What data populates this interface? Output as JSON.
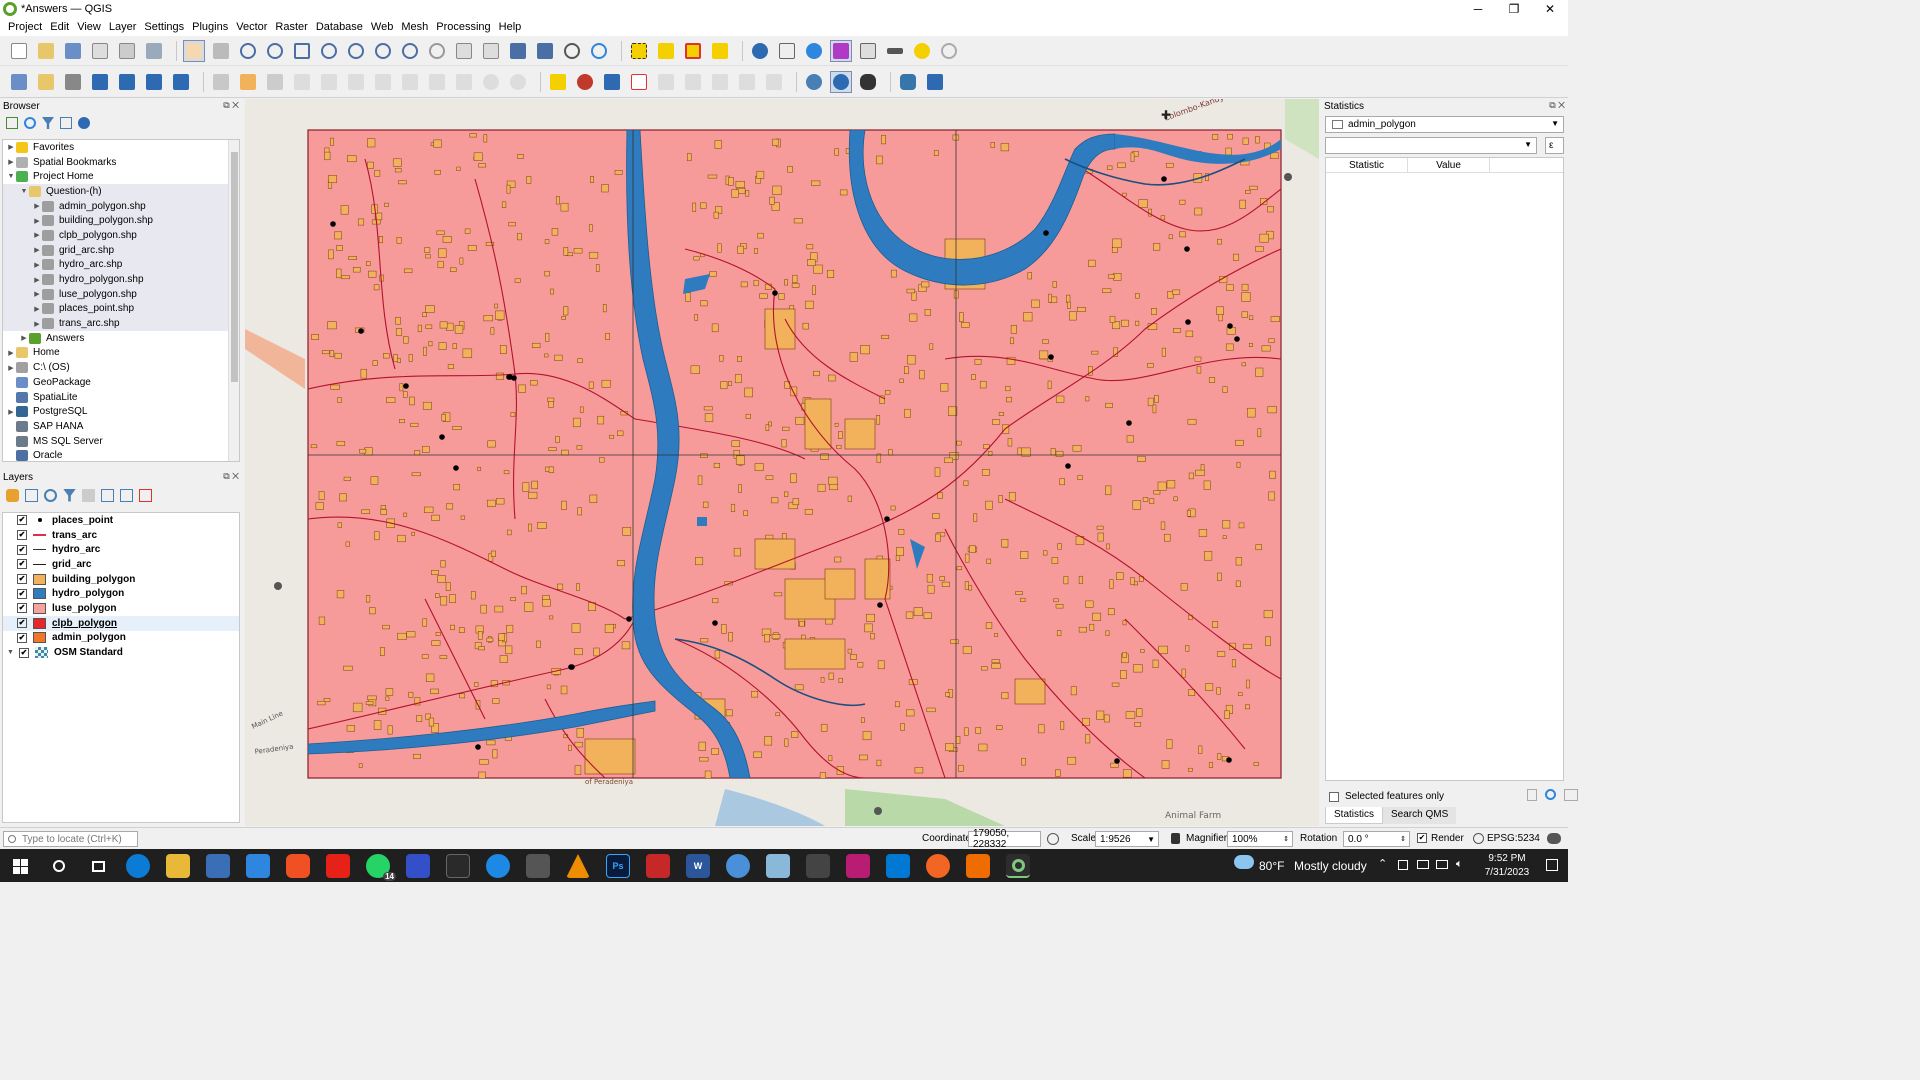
{
  "window": {
    "title": "*Answers — QGIS",
    "minimize": "─",
    "maximize": "❐",
    "close": "✕"
  },
  "menu": [
    "Project",
    "Edit",
    "View",
    "Layer",
    "Settings",
    "Plugins",
    "Vector",
    "Raster",
    "Database",
    "Web",
    "Mesh",
    "Processing",
    "Help"
  ],
  "browser": {
    "title": "Browser",
    "items": [
      {
        "label": "Favorites",
        "icon": "star-icon",
        "color": "#f5c518",
        "level": 0,
        "arrow": "▶"
      },
      {
        "label": "Spatial Bookmarks",
        "icon": "bookmark-icon",
        "color": "#b0b0b0",
        "level": 0,
        "arrow": "▶"
      },
      {
        "label": "Project Home",
        "icon": "project-home-icon",
        "color": "#4caf50",
        "level": 0,
        "arrow": "▼"
      },
      {
        "label": "Question-(h)",
        "icon": "folder-icon",
        "color": "#e8c66a",
        "level": 1,
        "arrow": "▼"
      },
      {
        "label": "admin_polygon.shp",
        "icon": "shapefile-icon",
        "color": "#9e9e9e",
        "level": 2,
        "arrow": "▶"
      },
      {
        "label": "building_polygon.shp",
        "icon": "shapefile-icon",
        "color": "#9e9e9e",
        "level": 2,
        "arrow": "▶"
      },
      {
        "label": "clpb_polygon.shp",
        "icon": "shapefile-icon",
        "color": "#9e9e9e",
        "level": 2,
        "arrow": "▶"
      },
      {
        "label": "grid_arc.shp",
        "icon": "shapefile-icon",
        "color": "#9e9e9e",
        "level": 2,
        "arrow": "▶"
      },
      {
        "label": "hydro_arc.shp",
        "icon": "shapefile-icon",
        "color": "#9e9e9e",
        "level": 2,
        "arrow": "▶"
      },
      {
        "label": "hydro_polygon.shp",
        "icon": "shapefile-icon",
        "color": "#9e9e9e",
        "level": 2,
        "arrow": "▶"
      },
      {
        "label": "luse_polygon.shp",
        "icon": "shapefile-icon",
        "color": "#9e9e9e",
        "level": 2,
        "arrow": "▶"
      },
      {
        "label": "places_point.shp",
        "icon": "shapefile-icon",
        "color": "#9e9e9e",
        "level": 2,
        "arrow": "▶"
      },
      {
        "label": "trans_arc.shp",
        "icon": "shapefile-icon",
        "color": "#9e9e9e",
        "level": 2,
        "arrow": "▶"
      },
      {
        "label": "Answers",
        "icon": "qgis-project-icon",
        "color": "#5aa02c",
        "level": 1,
        "arrow": "▶"
      },
      {
        "label": "Home",
        "icon": "folder-icon",
        "color": "#e8c66a",
        "level": 0,
        "arrow": "▶"
      },
      {
        "label": "C:\\ (OS)",
        "icon": "drive-icon",
        "color": "#a0a0a0",
        "level": 0,
        "arrow": "▶"
      },
      {
        "label": "GeoPackage",
        "icon": "geopackage-icon",
        "color": "#6a8fc7",
        "level": 0,
        "arrow": ""
      },
      {
        "label": "SpatiaLite",
        "icon": "spatialite-icon",
        "color": "#5577aa",
        "level": 0,
        "arrow": ""
      },
      {
        "label": "PostgreSQL",
        "icon": "postgresql-icon",
        "color": "#336791",
        "level": 0,
        "arrow": "▶"
      },
      {
        "label": "SAP HANA",
        "icon": "database-icon",
        "color": "#6b7b8c",
        "level": 0,
        "arrow": ""
      },
      {
        "label": "MS SQL Server",
        "icon": "database-icon",
        "color": "#6b7b8c",
        "level": 0,
        "arrow": ""
      },
      {
        "label": "Oracle",
        "icon": "oracle-icon",
        "color": "#4d6fa3",
        "level": 0,
        "arrow": ""
      }
    ]
  },
  "layers": {
    "title": "Layers",
    "items": [
      {
        "label": "places_point",
        "symbol": "point",
        "color": "#000000",
        "checked": "✔"
      },
      {
        "label": "trans_arc",
        "symbol": "line",
        "color": "#d9304b",
        "checked": "✔"
      },
      {
        "label": "hydro_arc",
        "symbol": "line",
        "color": "#333333",
        "checked": "✔"
      },
      {
        "label": "grid_arc",
        "symbol": "line",
        "color": "#222222",
        "checked": "✔"
      },
      {
        "label": "building_polygon",
        "symbol": "fill",
        "color": "#f2b25c",
        "checked": "✔"
      },
      {
        "label": "hydro_polygon",
        "symbol": "fill",
        "color": "#2f7cbf",
        "checked": "✔"
      },
      {
        "label": "luse_polygon",
        "symbol": "fill",
        "color": "#f7a1a1",
        "checked": "✔"
      },
      {
        "label": "clpb_polygon",
        "symbol": "fill",
        "color": "#e8262a",
        "checked": "✔"
      },
      {
        "label": "admin_polygon",
        "symbol": "fill",
        "color": "#f0762a",
        "checked": "✔"
      },
      {
        "label": "OSM Standard",
        "symbol": "raster",
        "color": "#5a7aa8",
        "checked": "✔"
      }
    ]
  },
  "stats": {
    "title": "Statistics",
    "layer": "admin_polygon",
    "field": "",
    "col_statistic": "Statistic",
    "col_value": "Value",
    "selected_only": "Selected features only",
    "tab_statistics": "Statistics",
    "tab_qms": "Search QMS"
  },
  "map_labels": {
    "colombo_kandy": "Colombo-Kandy",
    "peradeniya": "Peradeniya",
    "main_line": "Main Line",
    "animal_farm": "Animal Farm",
    "of_peradeniya": "of Peradeniya"
  },
  "statusbar": {
    "locate_placeholder": "Type to locate (Ctrl+K)",
    "coordinate_label": "Coordinate",
    "coordinate": "179050, 228332",
    "scale_label": "Scale",
    "scale": "1:9526",
    "magnifier_label": "Magnifier",
    "magnifier": "100%",
    "rotation_label": "Rotation",
    "rotation": "0.0 °",
    "render_label": "Render",
    "crs": "EPSG:5234"
  },
  "taskbar": {
    "weather_temp": "80°F",
    "weather_desc": "Mostly cloudy",
    "time": "9:52 PM",
    "date": "7/31/2023",
    "whatsapp_badge": "14"
  }
}
